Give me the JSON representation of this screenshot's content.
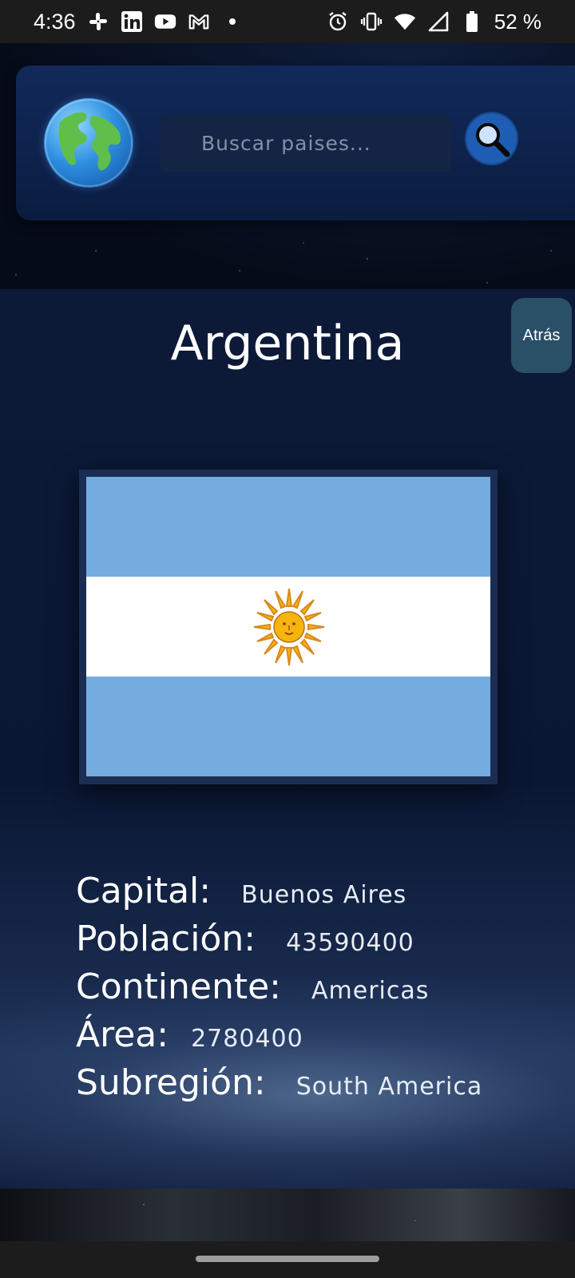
{
  "status_bar": {
    "time": "4:36",
    "battery": "52 %",
    "left_icons": [
      "slack-icon",
      "linkedin-icon",
      "youtube-icon",
      "gmail-icon",
      "dot-icon"
    ],
    "right_icons": [
      "alarm-icon",
      "vibrate-icon",
      "wifi-icon",
      "signal-icon",
      "battery-icon"
    ]
  },
  "header": {
    "logo_icon": "globe-icon",
    "search": {
      "placeholder": "Buscar paises...",
      "value": ""
    },
    "search_button_icon": "search-icon"
  },
  "detail": {
    "back_label": "Atrás",
    "country_name": "Argentina",
    "flag": {
      "country": "Argentina",
      "colors": [
        "#74acdf",
        "#ffffff",
        "#74acdf"
      ],
      "emblem": "sun-of-may"
    },
    "info": [
      {
        "label": "Capital:",
        "value": "Buenos Aires"
      },
      {
        "label": "Población:",
        "value": "43590400"
      },
      {
        "label": "Continente:",
        "value": "Americas"
      },
      {
        "label": "Área:",
        "value": "2780400"
      },
      {
        "label": "Subregión:",
        "value": "South America"
      }
    ]
  },
  "colors": {
    "accent": "#1e5db3",
    "back_button": "#2a5068",
    "header_card": "#11295a",
    "flag_blue": "#74acdf"
  }
}
